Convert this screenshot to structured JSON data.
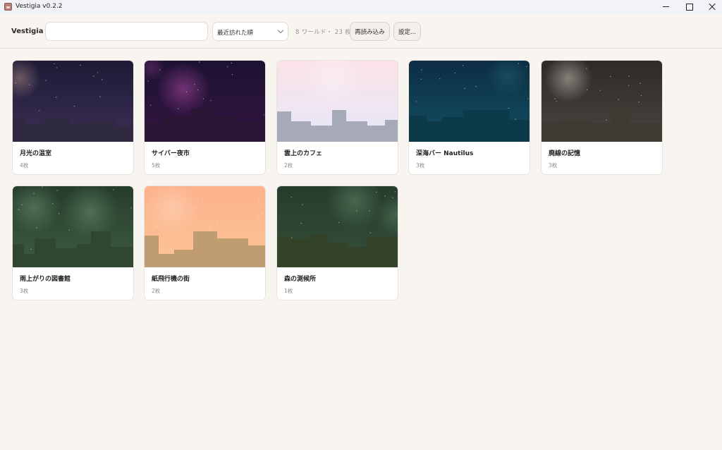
{
  "window": {
    "title": "Vestigia v0.2.2"
  },
  "toolbar": {
    "brand": "Vestigia",
    "search_value": "",
    "search_placeholder": "",
    "sort_label": "最近訪れた順",
    "counts": "8 ワールド・ 23 枚",
    "reload_label": "再読み込み",
    "settings_label": "設定..."
  },
  "worlds": [
    {
      "title": "月光の温室",
      "count": "4枚",
      "colors": {
        "top": "#1c1a35",
        "bottom": "#3c2f55",
        "silhouette": "#2f2a42",
        "glow": "#c9a090"
      }
    },
    {
      "title": "サイバー夜市",
      "count": "5枚",
      "colors": {
        "top": "#1d1232",
        "bottom": "#331542",
        "silhouette": "#2b1535",
        "glow": "#b04aa6"
      }
    },
    {
      "title": "雲上のカフェ",
      "count": "2枚",
      "colors": {
        "top": "#fbe2e8",
        "bottom": "#e5e8f8",
        "silhouette": "#a6aab8",
        "glow": "#ffffff"
      }
    },
    {
      "title": "深海バー Nautilus",
      "count": "3枚",
      "colors": {
        "top": "#0d2d44",
        "bottom": "#125060",
        "silhouette": "#0d3a48",
        "glow": "#3aa6b6"
      }
    },
    {
      "title": "廃線の記憶",
      "count": "3枚",
      "colors": {
        "top": "#2d2a28",
        "bottom": "#4a443e",
        "silhouette": "#3f3a34",
        "glow": "#d8cfc6"
      }
    },
    {
      "title": "雨上がりの図書館",
      "count": "3枚",
      "colors": {
        "top": "#253d2c",
        "bottom": "#3f5c40",
        "silhouette": "#2f4730",
        "glow": "#8fb98f"
      }
    },
    {
      "title": "紙飛行機の街",
      "count": "2枚",
      "colors": {
        "top": "#fcb18a",
        "bottom": "#fdc597",
        "silhouette": "#c09d70",
        "glow": "#ffd9c2"
      }
    },
    {
      "title": "森の測候所",
      "count": "1枚",
      "colors": {
        "top": "#263c2c",
        "bottom": "#34503a",
        "silhouette": "#33432a",
        "glow": "#7fb087"
      }
    }
  ]
}
